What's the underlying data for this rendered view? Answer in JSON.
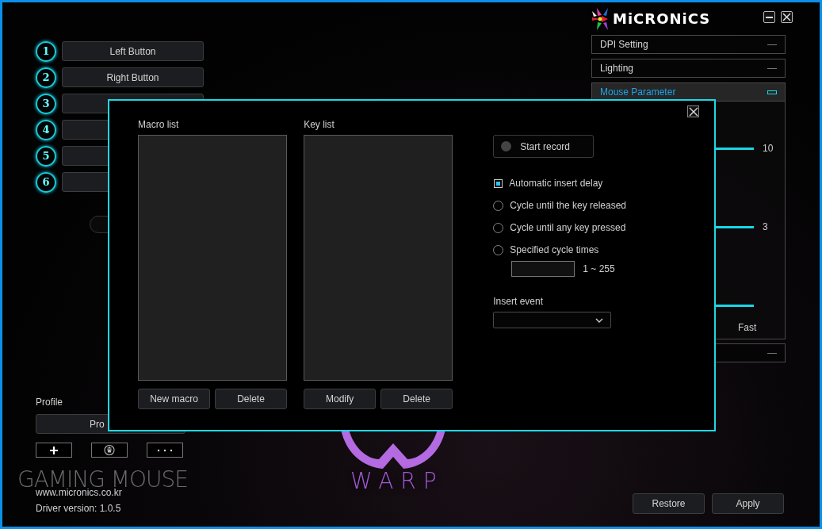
{
  "mouse_buttons": [
    {
      "number": "1",
      "label": "Left Button"
    },
    {
      "number": "2",
      "label": "Right Button"
    },
    {
      "number": "3"
    },
    {
      "number": "4"
    },
    {
      "number": "5"
    },
    {
      "number": "6"
    }
  ],
  "profile": {
    "title": "Profile",
    "current": "Pro"
  },
  "branding": {
    "brand_logo": "MiCRONiCS",
    "product": "GAMING MOUSE",
    "website": "www.micronics.co.kr",
    "driver_version": "Driver version: 1.0.5",
    "model_logo": "WARP"
  },
  "settings_panel": [
    {
      "label": "DPI Setting",
      "expanded": false
    },
    {
      "label": "Lighting",
      "expanded": false
    },
    {
      "label": "Mouse Parameter",
      "expanded": true,
      "sliders": [
        {
          "reading": "10"
        },
        {
          "reading": "3"
        },
        {
          "end_label": "Fast"
        }
      ]
    },
    {
      "expanded": false
    }
  ],
  "footer_buttons": [
    "Restore",
    "Apply"
  ],
  "macro_dialog": {
    "macro_list": {
      "title": "Macro list",
      "buttons": [
        "New macro",
        "Delete"
      ]
    },
    "key_list": {
      "title": "Key list",
      "buttons": [
        "Modify",
        "Delete"
      ]
    },
    "record_button": "Start record",
    "options": [
      {
        "kind": "checkbox",
        "label": "Automatic insert delay",
        "checked": true
      },
      {
        "kind": "radio",
        "label": "Cycle until the key released",
        "selected": false
      },
      {
        "kind": "radio",
        "label": "Cycle until any key pressed",
        "selected": false
      },
      {
        "kind": "radio",
        "label": "Specified cycle times",
        "selected": false
      }
    ],
    "cycle_range": "1 ~ 255",
    "insert_event": {
      "label": "Insert event"
    }
  }
}
